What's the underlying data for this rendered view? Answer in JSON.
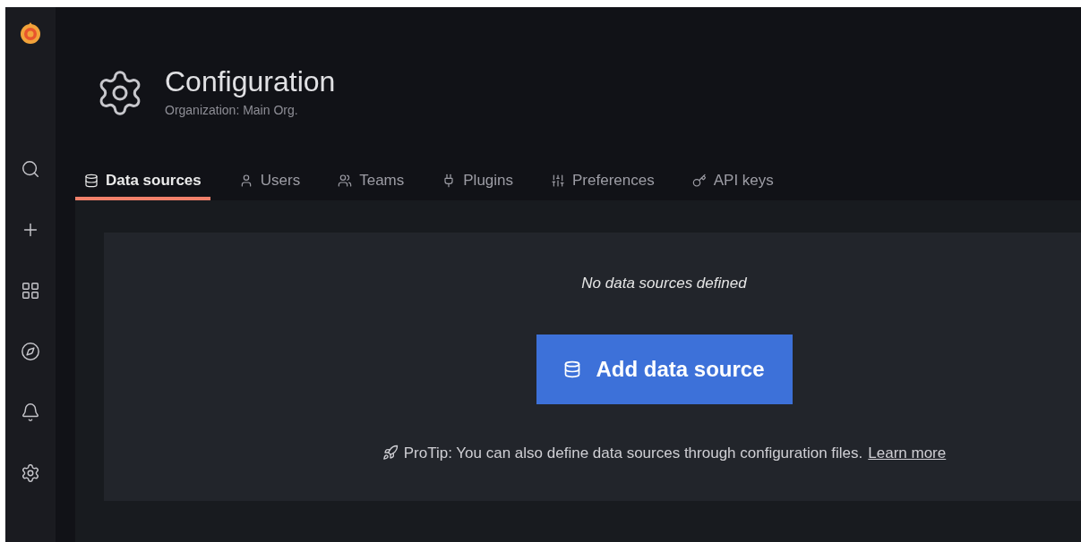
{
  "header": {
    "title": "Configuration",
    "subtitle": "Organization: Main Org."
  },
  "tabs": [
    {
      "label": "Data sources",
      "selected": true
    },
    {
      "label": "Users",
      "selected": false
    },
    {
      "label": "Teams",
      "selected": false
    },
    {
      "label": "Plugins",
      "selected": false
    },
    {
      "label": "Preferences",
      "selected": false
    },
    {
      "label": "API keys",
      "selected": false
    }
  ],
  "empty_state": {
    "message": "No data sources defined",
    "button": "Add data source",
    "protip": "ProTip: You can also define data sources through configuration files.",
    "link": "Learn more"
  }
}
